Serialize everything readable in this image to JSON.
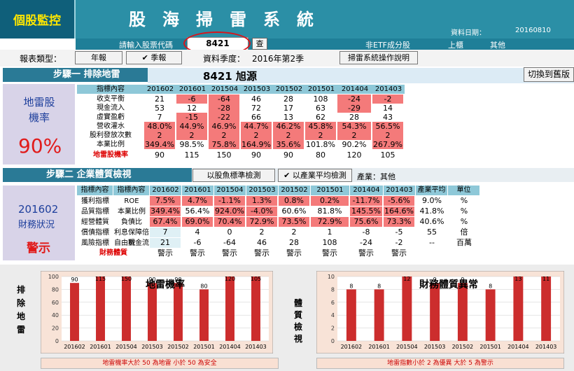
{
  "header": {
    "logo": "個股監控",
    "title_chars": [
      "股",
      "海",
      "掃",
      "雷",
      "系",
      "統"
    ],
    "date_label": "資料日期：",
    "date_value": "20160810",
    "etf_label": "非ETF成分股",
    "market": "上櫃",
    "category": "其他"
  },
  "input": {
    "prompt": "請輸入股票代碼",
    "code": "8421",
    "query_btn": "查"
  },
  "report": {
    "type_label": "報表類型：",
    "annual_btn": "年報",
    "quarter_btn": "✔ 季報",
    "season_label": "資料季度：",
    "season_value": "2016年第2季",
    "help_btn": "掃雷系統操作說明"
  },
  "step1": {
    "title": "步驟一 排除地雷",
    "stock": "8421  旭源",
    "switch_btn": "切換到舊版",
    "left_title": "地雷股機率",
    "left_value": "90%",
    "header": [
      "指標內容",
      "201602",
      "201601",
      "201504",
      "201503",
      "201502",
      "201501",
      "201404",
      "201403"
    ],
    "rows": [
      {
        "label": "收支平衡",
        "values": [
          "21",
          "-6",
          "-64",
          "46",
          "28",
          "108",
          "-24",
          "-2"
        ],
        "red": [
          false,
          true,
          true,
          false,
          false,
          false,
          true,
          true
        ]
      },
      {
        "label": "現金流入",
        "values": [
          "53",
          "12",
          "-28",
          "72",
          "17",
          "63",
          "-29",
          "14"
        ],
        "red": [
          false,
          false,
          true,
          false,
          false,
          false,
          true,
          false
        ]
      },
      {
        "label": "虛實盈虧",
        "values": [
          "7",
          "-15",
          "-22",
          "66",
          "13",
          "62",
          "28",
          "43"
        ],
        "red": [
          false,
          true,
          true,
          false,
          false,
          false,
          false,
          false
        ]
      },
      {
        "label": "營收灌水",
        "values": [
          "48.0%",
          "44.9%",
          "46.9%",
          "44.7%",
          "46.2%",
          "45.8%",
          "54.3%",
          "56.5%"
        ],
        "red": [
          true,
          true,
          true,
          true,
          true,
          true,
          true,
          true
        ]
      },
      {
        "label": "股利發放次數",
        "values": [
          "2",
          "2",
          "2",
          "2",
          "2",
          "2",
          "2",
          "2"
        ],
        "red": [
          true,
          true,
          true,
          true,
          true,
          true,
          true,
          true
        ]
      },
      {
        "label": "本業比例",
        "values": [
          "349.4%",
          "98.5%",
          "75.8%",
          "164.9%",
          "35.6%",
          "101.8%",
          "90.2%",
          "267.9%"
        ],
        "red": [
          true,
          false,
          true,
          true,
          true,
          false,
          false,
          true
        ]
      }
    ],
    "prob_row": {
      "label": "地雷股機率",
      "values": [
        "90",
        "115",
        "150",
        "90",
        "90",
        "80",
        "120",
        "105"
      ]
    }
  },
  "step2": {
    "title": "步驟二 企業體質檢視",
    "btn_fish": "以股魚標準檢測",
    "btn_ind": "✔ 以產業平均檢測",
    "industry": "產業：其他",
    "left_period": "201602",
    "left_sub": "財務狀況",
    "left_status": "警示",
    "header": [
      "指標內容",
      "指標內容",
      "201602",
      "201601",
      "201504",
      "201503",
      "201502",
      "201501",
      "201404",
      "201403",
      "產業平均",
      "單位"
    ],
    "rows": [
      {
        "cat": "獲利指標",
        "label": "ROE",
        "values": [
          "7.5%",
          "4.7%",
          "-1.1%",
          "1.3%",
          "0.8%",
          "0.2%",
          "-11.7%",
          "-5.6%"
        ],
        "red": [
          true,
          true,
          true,
          true,
          true,
          true,
          true,
          true
        ],
        "avg": "9.0%",
        "unit": "%"
      },
      {
        "cat": "品質指標",
        "label": "本業比例",
        "values": [
          "349.4%",
          "56.4%",
          "924.0%",
          "-4.0%",
          "60.6%",
          "81.8%",
          "145.5%",
          "164.6%"
        ],
        "red": [
          true,
          false,
          true,
          true,
          false,
          false,
          true,
          true
        ],
        "avg": "41.8%",
        "unit": "%"
      },
      {
        "cat": "經營體質",
        "label": "負債比",
        "values": [
          "67.4%",
          "69.0%",
          "70.4%",
          "72.9%",
          "73.5%",
          "72.9%",
          "75.6%",
          "73.3%"
        ],
        "red": [
          true,
          true,
          true,
          true,
          true,
          true,
          true,
          true
        ],
        "avg": "40.6%",
        "unit": "%"
      },
      {
        "cat": "償債指標",
        "label": "利息保障倍數",
        "values": [
          "7",
          "4",
          "0",
          "2",
          "2",
          "1",
          "-8",
          "-5"
        ],
        "red": [
          false,
          false,
          false,
          false,
          false,
          false,
          false,
          false
        ],
        "avg": "55",
        "unit": "倍"
      },
      {
        "cat": "風險指標",
        "label": "自由現金流",
        "values": [
          "21",
          "-6",
          "-64",
          "46",
          "28",
          "108",
          "-24",
          "-2"
        ],
        "red": [
          false,
          false,
          false,
          false,
          false,
          false,
          false,
          false
        ],
        "avg": "--",
        "unit": "百萬"
      }
    ],
    "status_row": {
      "label": "財務體質",
      "values": [
        "警示",
        "警示",
        "警示",
        "警示",
        "警示",
        "警示",
        "警示",
        "警示"
      ]
    }
  },
  "chart_data": [
    {
      "type": "bar",
      "title": "地雷機率",
      "side_label": "排除地雷",
      "categories": [
        "201602",
        "201601",
        "201504",
        "201503",
        "201502",
        "201501",
        "201404",
        "201403"
      ],
      "values": [
        90,
        115,
        150,
        90,
        90,
        80,
        120,
        105
      ],
      "ylim": [
        0,
        100
      ],
      "yticks": [
        0,
        20,
        40,
        60,
        80,
        100
      ],
      "footer": "地雷機率大於 50 為地雷  小於 50 為安全",
      "bar_color": "#cc2d2d"
    },
    {
      "type": "bar",
      "title": "財務體質異常",
      "side_label": "體質檢視",
      "categories": [
        "201602",
        "201601",
        "201504",
        "201503",
        "201502",
        "201501",
        "201404",
        "201403"
      ],
      "values": [
        8,
        8,
        12,
        9,
        9,
        8,
        13,
        11
      ],
      "ylim": [
        0,
        10
      ],
      "yticks": [
        0,
        2,
        4,
        6,
        8,
        10
      ],
      "footer": "地雷指數小於 2 為優異  大於 5 為警示",
      "bar_color": "#cc2d2d"
    }
  ]
}
